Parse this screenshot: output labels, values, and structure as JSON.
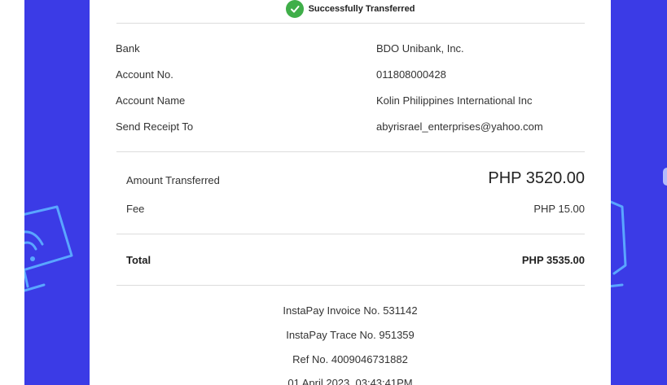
{
  "receipt": {
    "status_text": "Successfully Transferred",
    "details": [
      {
        "label": "Bank",
        "value": "BDO Unibank, Inc."
      },
      {
        "label": "Account No.",
        "value": "011808000428"
      },
      {
        "label": "Account Name",
        "value": "Kolin Philippines International Inc"
      },
      {
        "label": "Send Receipt To",
        "value": "abyrisrael_enterprises@yahoo.com"
      }
    ],
    "amount_transferred": {
      "label": "Amount Transferred",
      "value": "PHP 3520.00"
    },
    "fee": {
      "label": "Fee",
      "value": "PHP 15.00"
    },
    "total": {
      "label": "Total",
      "value": "PHP 3535.00"
    },
    "invoice_no": "InstaPay Invoice No. 531142",
    "trace_no": "InstaPay Trace No. 951359",
    "ref_no": "Ref No. 4009046731882",
    "datetime": "01 April 2023, 03:43:41PM"
  },
  "colors": {
    "background_band": "#3b3be6",
    "success": "#3fae49",
    "deco_stroke": "#5aa6ff"
  },
  "icons": {
    "status": "check-circle-icon",
    "decoration_left": "router-icon",
    "decoration_right": "device-icon"
  }
}
